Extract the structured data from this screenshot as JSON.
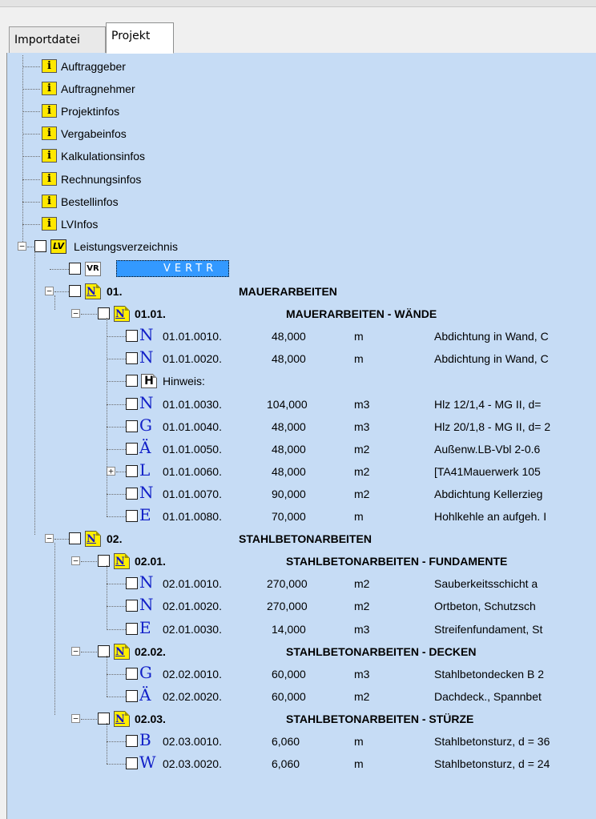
{
  "tabs": [
    {
      "label": "Importdatei",
      "active": false
    },
    {
      "label": "Projekt",
      "active": true
    }
  ],
  "info_nodes": [
    {
      "label": "Auftraggeber"
    },
    {
      "label": "Auftragnehmer"
    },
    {
      "label": "Projektinfos"
    },
    {
      "label": "Vergabeinfos"
    },
    {
      "label": "Kalkulationsinfos"
    },
    {
      "label": "Rechnungsinfos"
    },
    {
      "label": "Bestellinfos"
    },
    {
      "label": "LVInfos"
    }
  ],
  "icons": {
    "info": "i",
    "lv": "LV",
    "vr": "VR",
    "n_folder": "N",
    "hinweis": "H",
    "expanded": "−",
    "collapsed": "+"
  },
  "lv_root": {
    "label": "Leistungsverzeichnis"
  },
  "vertr": {
    "label": "VERTR"
  },
  "tree": [
    {
      "kind": "group",
      "level": 1,
      "ordinal": "01.",
      "title": "MAUERARBEITEN"
    },
    {
      "kind": "group",
      "level": 2,
      "ordinal": "01.01.",
      "title": "MAUERARBEITEN - WÄNDE"
    },
    {
      "kind": "pos",
      "type": "N",
      "ordinal": "01.01.0010.",
      "qty": "48,000",
      "unit": "m",
      "text": "Abdichtung in Wand, C"
    },
    {
      "kind": "pos",
      "type": "N",
      "ordinal": "01.01.0020.",
      "qty": "48,000",
      "unit": "m",
      "text": "Abdichtung in Wand, C"
    },
    {
      "kind": "note",
      "label": "Hinweis:"
    },
    {
      "kind": "pos",
      "type": "N",
      "ordinal": "01.01.0030.",
      "qty": "104,000",
      "unit": "m3",
      "text": "Hlz 12/1,4 - MG II, d="
    },
    {
      "kind": "pos",
      "type": "G",
      "ordinal": "01.01.0040.",
      "qty": "48,000",
      "unit": "m3",
      "text": "Hlz 20/1,8 - MG II, d= 2"
    },
    {
      "kind": "pos",
      "type": "Ä",
      "ordinal": "01.01.0050.",
      "qty": "48,000",
      "unit": "m2",
      "text": "Außenw.LB-Vbl 2-0.6"
    },
    {
      "kind": "pos",
      "type": "L",
      "ordinal": "01.01.0060.",
      "qty": "48,000",
      "unit": "m2",
      "text": "[TA41Mauerwerk 105",
      "collapsed": true
    },
    {
      "kind": "pos",
      "type": "N",
      "ordinal": "01.01.0070.",
      "qty": "90,000",
      "unit": "m2",
      "text": "Abdichtung Kellerzieg"
    },
    {
      "kind": "pos",
      "type": "E",
      "ordinal": "01.01.0080.",
      "qty": "70,000",
      "unit": "m",
      "text": "Hohlkehle an aufgeh. I"
    },
    {
      "kind": "group",
      "level": 1,
      "ordinal": "02.",
      "title": "STAHLBETONARBEITEN"
    },
    {
      "kind": "group",
      "level": 2,
      "ordinal": "02.01.",
      "title": "STAHLBETONARBEITEN - FUNDAMENTE"
    },
    {
      "kind": "pos",
      "type": "N",
      "ordinal": "02.01.0010.",
      "qty": "270,000",
      "unit": "m2",
      "text": "Sauberkeitsschicht a"
    },
    {
      "kind": "pos",
      "type": "N",
      "ordinal": "02.01.0020.",
      "qty": "270,000",
      "unit": "m2",
      "text": "Ortbeton, Schutzsch"
    },
    {
      "kind": "pos",
      "type": "E",
      "ordinal": "02.01.0030.",
      "qty": "14,000",
      "unit": "m3",
      "text": "Streifenfundament, St"
    },
    {
      "kind": "group",
      "level": 2,
      "ordinal": "02.02.",
      "title": "STAHLBETONARBEITEN - DECKEN"
    },
    {
      "kind": "pos",
      "type": "G",
      "ordinal": "02.02.0010.",
      "qty": "60,000",
      "unit": "m3",
      "text": "Stahlbetondecken B 2"
    },
    {
      "kind": "pos",
      "type": "Ä",
      "ordinal": "02.02.0020.",
      "qty": "60,000",
      "unit": "m2",
      "text": "Dachdeck., Spannbet"
    },
    {
      "kind": "group",
      "level": 2,
      "ordinal": "02.03.",
      "title": "STAHLBETONARBEITEN - STÜRZE"
    },
    {
      "kind": "pos",
      "type": "B",
      "ordinal": "02.03.0010.",
      "qty": "6,060",
      "unit": "m",
      "text": "Stahlbetonsturz, d = 36"
    },
    {
      "kind": "pos",
      "type": "W",
      "ordinal": "02.03.0020.",
      "qty": "6,060",
      "unit": "m",
      "text": "Stahlbetonsturz, d = 24"
    }
  ],
  "colors": {
    "panel_bg": "#c6dcf5",
    "selection": "#3399ff",
    "type_letter": "#1220c8",
    "icon_yellow": "#ffe800"
  }
}
